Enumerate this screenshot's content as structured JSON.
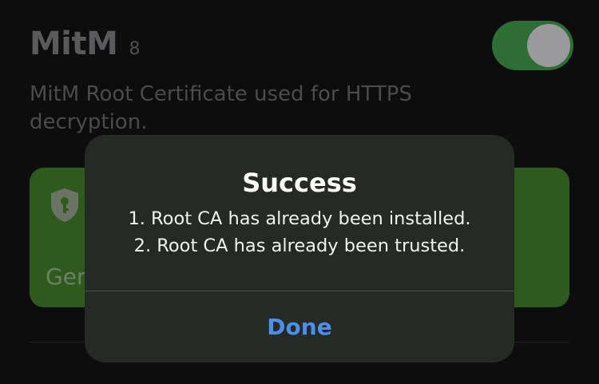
{
  "background": {
    "title": "MitM",
    "count": "8",
    "description": "MitM Root Certificate used for HTTPS decryption.",
    "toggle_on": true,
    "card_label": "Ger",
    "colors": {
      "toggle": "#2c6e34",
      "card": "#2e5a1e"
    }
  },
  "alert": {
    "title": "Success",
    "lines": [
      "1. Root CA has already been installed.",
      "2. Root CA has already been trusted."
    ],
    "button_label": "Done",
    "colors": {
      "button_text": "#4d8eea"
    }
  }
}
